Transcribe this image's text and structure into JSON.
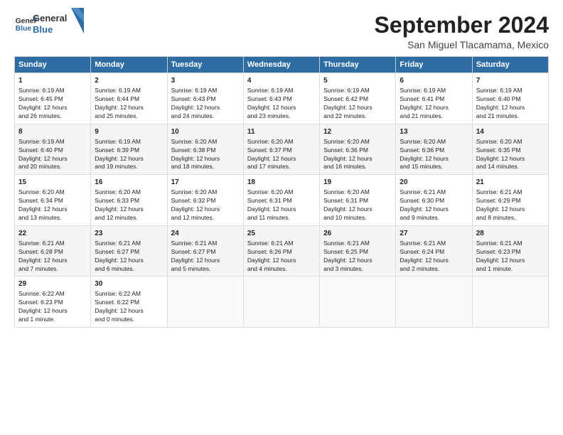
{
  "header": {
    "logo_line1": "General",
    "logo_line2": "Blue",
    "title": "September 2024",
    "subtitle": "San Miguel Tlacamama, Mexico"
  },
  "days_of_week": [
    "Sunday",
    "Monday",
    "Tuesday",
    "Wednesday",
    "Thursday",
    "Friday",
    "Saturday"
  ],
  "weeks": [
    [
      {
        "day": "1",
        "lines": [
          "Sunrise: 6:19 AM",
          "Sunset: 6:45 PM",
          "Daylight: 12 hours",
          "and 26 minutes."
        ]
      },
      {
        "day": "2",
        "lines": [
          "Sunrise: 6:19 AM",
          "Sunset: 6:44 PM",
          "Daylight: 12 hours",
          "and 25 minutes."
        ]
      },
      {
        "day": "3",
        "lines": [
          "Sunrise: 6:19 AM",
          "Sunset: 6:43 PM",
          "Daylight: 12 hours",
          "and 24 minutes."
        ]
      },
      {
        "day": "4",
        "lines": [
          "Sunrise: 6:19 AM",
          "Sunset: 6:43 PM",
          "Daylight: 12 hours",
          "and 23 minutes."
        ]
      },
      {
        "day": "5",
        "lines": [
          "Sunrise: 6:19 AM",
          "Sunset: 6:42 PM",
          "Daylight: 12 hours",
          "and 22 minutes."
        ]
      },
      {
        "day": "6",
        "lines": [
          "Sunrise: 6:19 AM",
          "Sunset: 6:41 PM",
          "Daylight: 12 hours",
          "and 21 minutes."
        ]
      },
      {
        "day": "7",
        "lines": [
          "Sunrise: 6:19 AM",
          "Sunset: 6:40 PM",
          "Daylight: 12 hours",
          "and 21 minutes."
        ]
      }
    ],
    [
      {
        "day": "8",
        "lines": [
          "Sunrise: 6:19 AM",
          "Sunset: 6:40 PM",
          "Daylight: 12 hours",
          "and 20 minutes."
        ]
      },
      {
        "day": "9",
        "lines": [
          "Sunrise: 6:19 AM",
          "Sunset: 6:39 PM",
          "Daylight: 12 hours",
          "and 19 minutes."
        ]
      },
      {
        "day": "10",
        "lines": [
          "Sunrise: 6:20 AM",
          "Sunset: 6:38 PM",
          "Daylight: 12 hours",
          "and 18 minutes."
        ]
      },
      {
        "day": "11",
        "lines": [
          "Sunrise: 6:20 AM",
          "Sunset: 6:37 PM",
          "Daylight: 12 hours",
          "and 17 minutes."
        ]
      },
      {
        "day": "12",
        "lines": [
          "Sunrise: 6:20 AM",
          "Sunset: 6:36 PM",
          "Daylight: 12 hours",
          "and 16 minutes."
        ]
      },
      {
        "day": "13",
        "lines": [
          "Sunrise: 6:20 AM",
          "Sunset: 6:36 PM",
          "Daylight: 12 hours",
          "and 15 minutes."
        ]
      },
      {
        "day": "14",
        "lines": [
          "Sunrise: 6:20 AM",
          "Sunset: 6:35 PM",
          "Daylight: 12 hours",
          "and 14 minutes."
        ]
      }
    ],
    [
      {
        "day": "15",
        "lines": [
          "Sunrise: 6:20 AM",
          "Sunset: 6:34 PM",
          "Daylight: 12 hours",
          "and 13 minutes."
        ]
      },
      {
        "day": "16",
        "lines": [
          "Sunrise: 6:20 AM",
          "Sunset: 6:33 PM",
          "Daylight: 12 hours",
          "and 12 minutes."
        ]
      },
      {
        "day": "17",
        "lines": [
          "Sunrise: 6:20 AM",
          "Sunset: 6:32 PM",
          "Daylight: 12 hours",
          "and 12 minutes."
        ]
      },
      {
        "day": "18",
        "lines": [
          "Sunrise: 6:20 AM",
          "Sunset: 6:31 PM",
          "Daylight: 12 hours",
          "and 11 minutes."
        ]
      },
      {
        "day": "19",
        "lines": [
          "Sunrise: 6:20 AM",
          "Sunset: 6:31 PM",
          "Daylight: 12 hours",
          "and 10 minutes."
        ]
      },
      {
        "day": "20",
        "lines": [
          "Sunrise: 6:21 AM",
          "Sunset: 6:30 PM",
          "Daylight: 12 hours",
          "and 9 minutes."
        ]
      },
      {
        "day": "21",
        "lines": [
          "Sunrise: 6:21 AM",
          "Sunset: 6:29 PM",
          "Daylight: 12 hours",
          "and 8 minutes."
        ]
      }
    ],
    [
      {
        "day": "22",
        "lines": [
          "Sunrise: 6:21 AM",
          "Sunset: 6:28 PM",
          "Daylight: 12 hours",
          "and 7 minutes."
        ]
      },
      {
        "day": "23",
        "lines": [
          "Sunrise: 6:21 AM",
          "Sunset: 6:27 PM",
          "Daylight: 12 hours",
          "and 6 minutes."
        ]
      },
      {
        "day": "24",
        "lines": [
          "Sunrise: 6:21 AM",
          "Sunset: 6:27 PM",
          "Daylight: 12 hours",
          "and 5 minutes."
        ]
      },
      {
        "day": "25",
        "lines": [
          "Sunrise: 6:21 AM",
          "Sunset: 6:26 PM",
          "Daylight: 12 hours",
          "and 4 minutes."
        ]
      },
      {
        "day": "26",
        "lines": [
          "Sunrise: 6:21 AM",
          "Sunset: 6:25 PM",
          "Daylight: 12 hours",
          "and 3 minutes."
        ]
      },
      {
        "day": "27",
        "lines": [
          "Sunrise: 6:21 AM",
          "Sunset: 6:24 PM",
          "Daylight: 12 hours",
          "and 2 minutes."
        ]
      },
      {
        "day": "28",
        "lines": [
          "Sunrise: 6:21 AM",
          "Sunset: 6:23 PM",
          "Daylight: 12 hours",
          "and 1 minute."
        ]
      }
    ],
    [
      {
        "day": "29",
        "lines": [
          "Sunrise: 6:22 AM",
          "Sunset: 6:23 PM",
          "Daylight: 12 hours",
          "and 1 minute."
        ]
      },
      {
        "day": "30",
        "lines": [
          "Sunrise: 6:22 AM",
          "Sunset: 6:22 PM",
          "Daylight: 12 hours",
          "and 0 minutes."
        ]
      },
      {
        "day": "",
        "lines": []
      },
      {
        "day": "",
        "lines": []
      },
      {
        "day": "",
        "lines": []
      },
      {
        "day": "",
        "lines": []
      },
      {
        "day": "",
        "lines": []
      }
    ]
  ]
}
